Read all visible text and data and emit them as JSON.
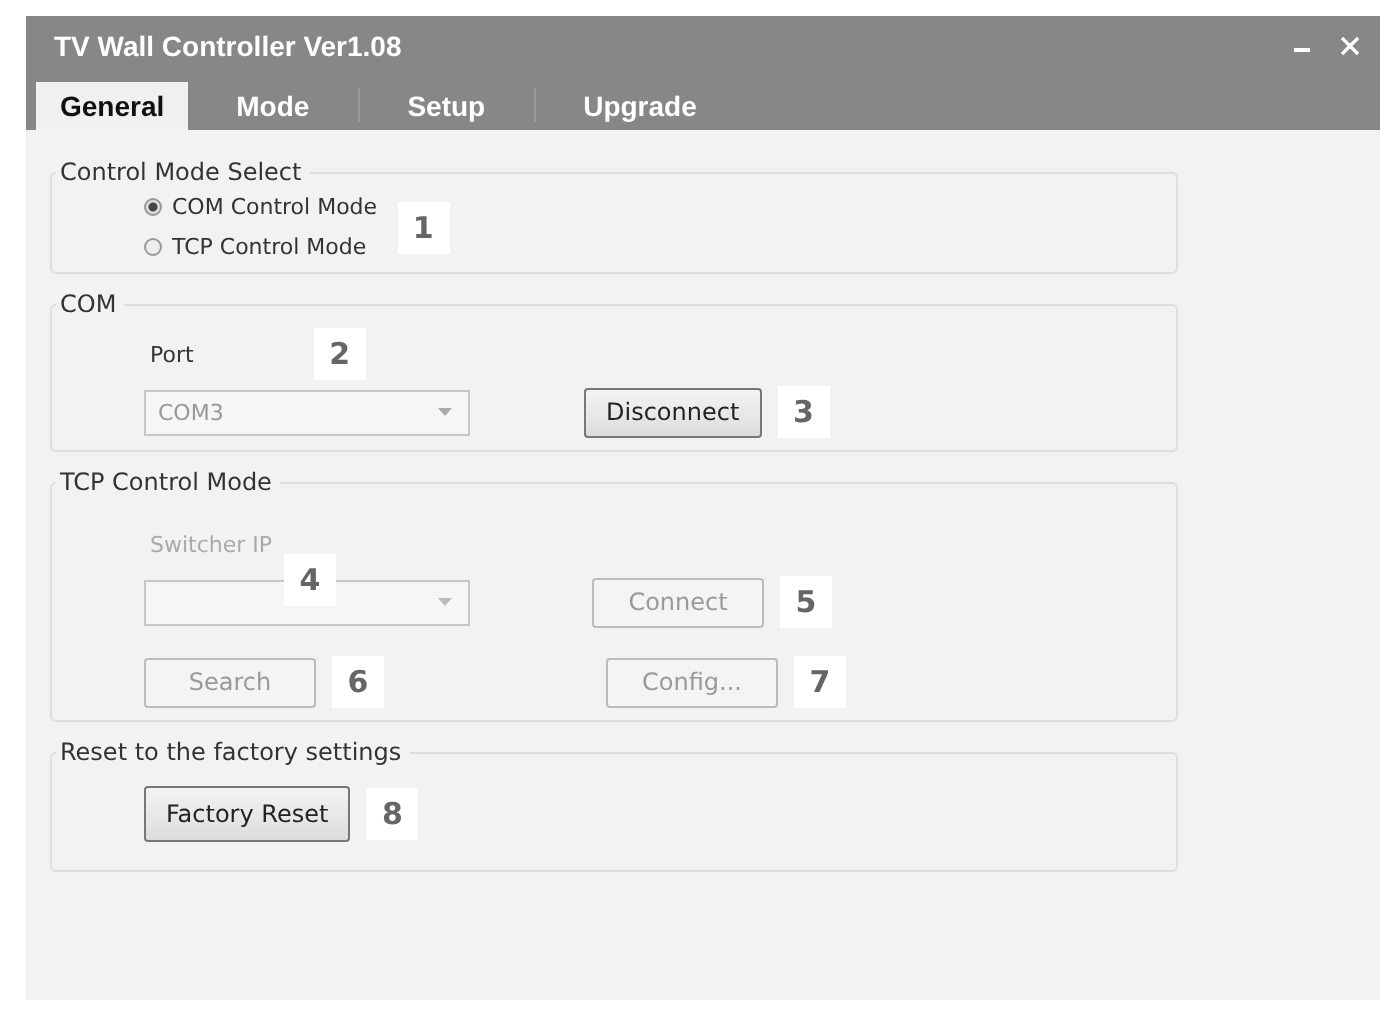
{
  "window": {
    "title": "TV Wall Controller Ver1.08"
  },
  "tabs": [
    {
      "label": "General",
      "selected": true
    },
    {
      "label": "Mode",
      "selected": false
    },
    {
      "label": "Setup",
      "selected": false
    },
    {
      "label": "Upgrade",
      "selected": false
    }
  ],
  "control_mode": {
    "title": "Control Mode Select",
    "callout": "1",
    "options": [
      {
        "label": "COM Control Mode",
        "selected": true
      },
      {
        "label": "TCP Control Mode",
        "selected": false
      }
    ]
  },
  "com": {
    "title": "COM",
    "port_label": "Port",
    "port_callout": "2",
    "port_value": "COM3",
    "button": {
      "label": "Disconnect",
      "disabled": false
    },
    "button_callout": "3"
  },
  "tcp": {
    "title": "TCP Control Mode",
    "ip_label": "Switcher IP",
    "ip_callout": "4",
    "ip_disabled": true,
    "connect": {
      "label": "Connect",
      "disabled": true,
      "callout": "5"
    },
    "search": {
      "label": "Search",
      "disabled": true,
      "callout": "6"
    },
    "config": {
      "label": "Config...",
      "disabled": true,
      "callout": "7"
    }
  },
  "reset": {
    "title": "Reset to the factory settings",
    "button": {
      "label": "Factory Reset",
      "disabled": false
    },
    "callout": "8"
  }
}
